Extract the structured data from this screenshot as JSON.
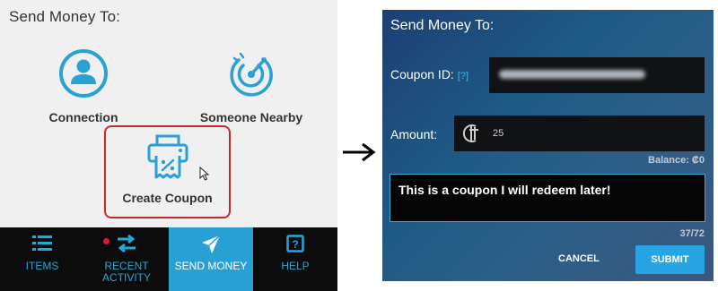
{
  "left_panel": {
    "title": "Send Money To:",
    "options": [
      {
        "label": "Connection",
        "icon": "user-circle-icon"
      },
      {
        "label": "Someone Nearby",
        "icon": "radar-icon"
      },
      {
        "label": "Create Coupon",
        "icon": "coupon-printer-icon",
        "highlighted": true
      }
    ],
    "nav": [
      {
        "label": "ITEMS",
        "icon": "list-icon"
      },
      {
        "label": "RECENT ACTIVITY",
        "icon": "transfer-arrows-icon",
        "notification_dot": true
      },
      {
        "label": "SEND MONEY",
        "icon": "paper-plane-icon",
        "active": true
      },
      {
        "label": "HELP",
        "icon": "help-box-icon"
      }
    ]
  },
  "right_panel": {
    "title": "Send Money To:",
    "coupon_label": "Coupon ID:",
    "coupon_help": "[?]",
    "amount_label": "Amount:",
    "amount_value": "25",
    "balance_text": "Balance: ₡0",
    "memo_text": "This is a coupon I will redeem later!",
    "char_count": "37/72",
    "cancel_label": "CANCEL",
    "submit_label": "SUBMIT"
  },
  "colors": {
    "accent": "#28a0d3",
    "highlight_border": "#cc2727",
    "nav_background": "#0c0c0c",
    "notification_dot": "#e8152e"
  }
}
